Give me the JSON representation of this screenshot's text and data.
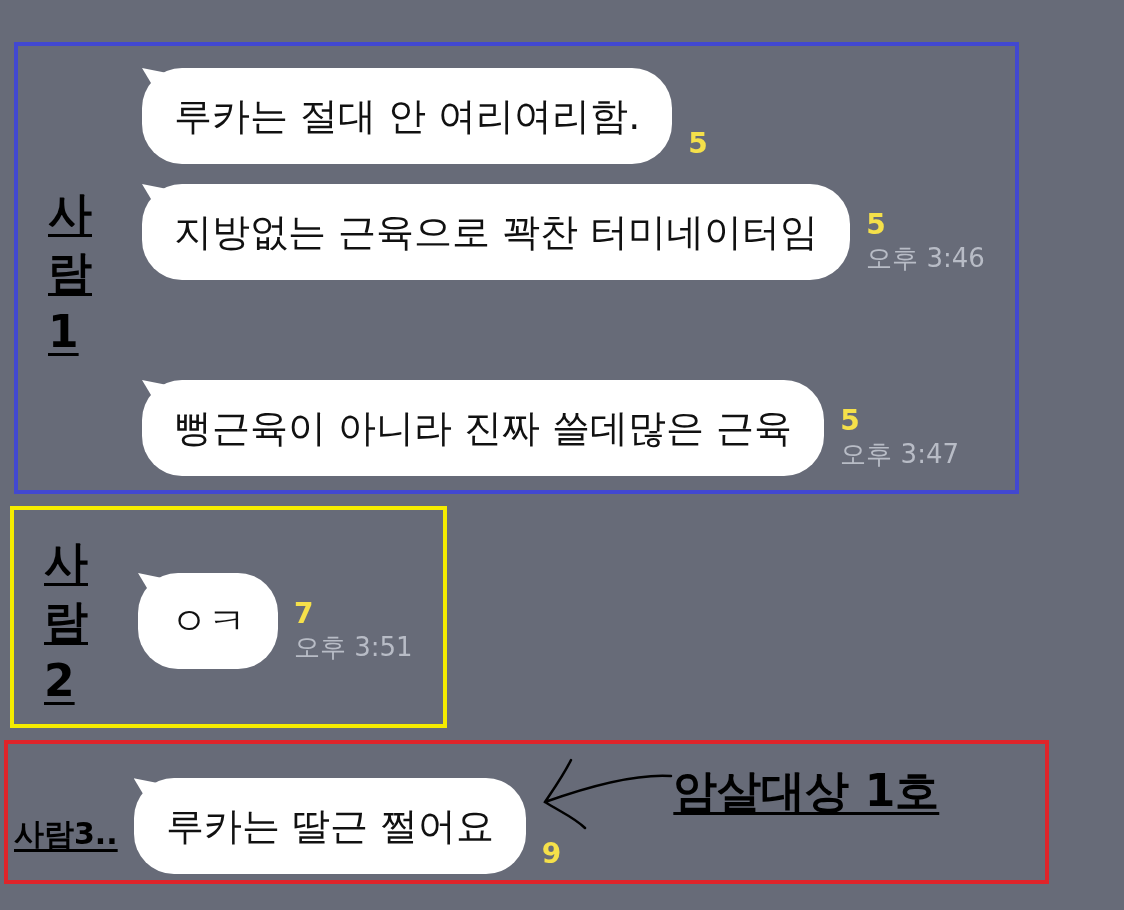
{
  "groups": [
    {
      "label": "사람1",
      "kind": "vertical",
      "color": "#4248d0",
      "messages": [
        {
          "text": "루카는 절대 안 여리여리함.",
          "unread": "5"
        },
        {
          "text": "지방없는 근육으로 꽉찬 터미네이터임",
          "unread": "5",
          "time": "오후 3:46"
        },
        {
          "text": "뻥근육이 아니라 진짜 쓸데많은 근육",
          "unread": "5",
          "time": "오후 3:47"
        }
      ]
    },
    {
      "label": "사람2",
      "kind": "vertical",
      "color": "#f5ec00",
      "messages": [
        {
          "text": "ㅇㅋ",
          "unread": "7",
          "time": "오후 3:51"
        }
      ]
    },
    {
      "label": "사람3..",
      "kind": "horizontal",
      "color": "#e0242a",
      "messages": [
        {
          "text": "루카는 딸근 쩔어요",
          "unread": "9"
        }
      ],
      "annotation": "암살대상 1호"
    }
  ]
}
